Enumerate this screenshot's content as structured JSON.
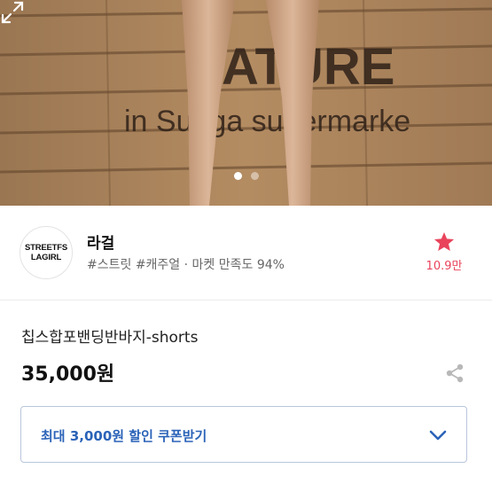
{
  "hero": {
    "sign_line1": "ATURE",
    "sign_line2": "in Sunga supermarke",
    "slide_count": 2,
    "active_slide": 1
  },
  "shop": {
    "logo_line1": "STREETFS",
    "logo_line2": "LAGIRL",
    "name": "라걸",
    "tags": "#스트릿 #캐주얼 · 마켓 만족도 94%",
    "favorite_count": "10.9만"
  },
  "product": {
    "name": "칩스합포밴딩반바지-shorts",
    "price": "35,000원"
  },
  "coupon": {
    "label": "최대 3,000원 할인 쿠폰받기"
  },
  "colors": {
    "accent_red": "#e9445c",
    "coupon_blue": "#2b63b8",
    "coupon_border": "#b9c6dc"
  },
  "icons": {
    "expand": "expand-icon",
    "favorite": "star-icon",
    "share": "share-icon",
    "coupon_toggle": "chevron-down-icon"
  }
}
